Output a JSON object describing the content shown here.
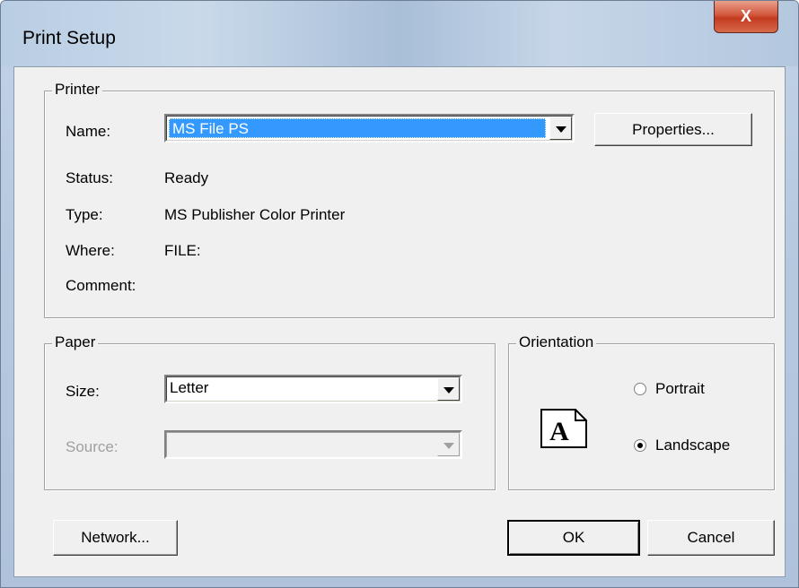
{
  "window": {
    "title": "Print Setup",
    "close_label": "X"
  },
  "printer": {
    "group_title": "Printer",
    "name_label": "Name:",
    "name_value": "MS File PS",
    "properties_button": "Properties...",
    "status_label": "Status:",
    "status_value": "Ready",
    "type_label": "Type:",
    "type_value": "MS Publisher Color Printer",
    "where_label": "Where:",
    "where_value": "FILE:",
    "comment_label": "Comment:"
  },
  "paper": {
    "group_title": "Paper",
    "size_label": "Size:",
    "size_value": "Letter",
    "source_label": "Source:",
    "source_value": ""
  },
  "orientation": {
    "group_title": "Orientation",
    "icon_letter": "A",
    "portrait_label": "Portrait",
    "landscape_label": "Landscape",
    "selected": "landscape"
  },
  "buttons": {
    "network": "Network...",
    "ok": "OK",
    "cancel": "Cancel"
  },
  "icons": {
    "close": "close-icon",
    "dropdown": "chevron-down-icon",
    "orientation": "page-letter-icon"
  }
}
